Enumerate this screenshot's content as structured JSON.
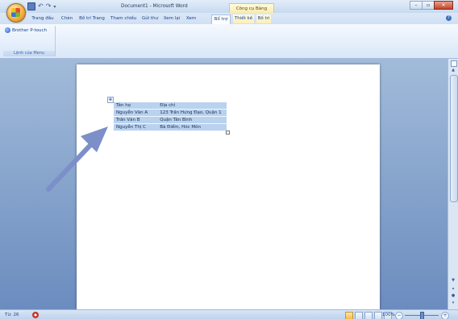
{
  "window": {
    "title": "Document1 - Microsoft Word",
    "context_group": "Công cụ Bảng"
  },
  "qat": {
    "save_icon": "save-icon",
    "undo_icon": "undo-icon",
    "redo_icon": "redo-icon"
  },
  "tabs": [
    {
      "label": "Trang đầu",
      "active": false
    },
    {
      "label": "Chèn",
      "active": false
    },
    {
      "label": "Bố trí Trang",
      "active": false
    },
    {
      "label": "Tham chiếu",
      "active": false
    },
    {
      "label": "Gửi thư",
      "active": false
    },
    {
      "label": "Xem lại",
      "active": false
    },
    {
      "label": "Xem",
      "active": false
    },
    {
      "label": "Bổ trợ",
      "active": true
    },
    {
      "label": "Thiết kế",
      "active": false
    },
    {
      "label": "Bố trí",
      "active": false
    }
  ],
  "ribbon": {
    "group_button": "Brother P-touch",
    "group_label": "Lệnh của Menu"
  },
  "document": {
    "table": {
      "headers": [
        "Tên họ",
        "Địa chỉ"
      ],
      "rows": [
        [
          "Nguyễn Văn A",
          "123 Trần Hưng Đạo, Quận 1"
        ],
        [
          "Trần Văn B",
          "Quận Tân Bình"
        ],
        [
          "Nguyễn Thị C",
          "Bà Điểm, Hóc Môn"
        ]
      ]
    }
  },
  "status": {
    "word_count": "Từ: 26",
    "zoom": "100%"
  },
  "colors": {
    "workspace": "#89a6cd",
    "table_selection": "#b9d2ee",
    "arrow": "#7d8fc9"
  }
}
